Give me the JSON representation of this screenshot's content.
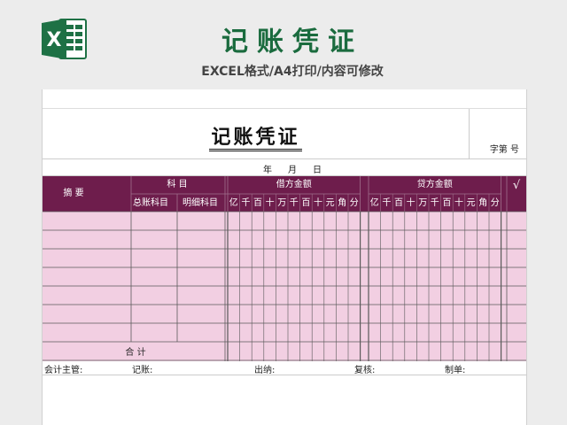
{
  "banner": {
    "title": "记账凭证",
    "subtitle": "EXCEL格式/A4打印/内容可修改"
  },
  "logo": {
    "letter": "X",
    "icon": "excel-icon",
    "color": "#1e7145"
  },
  "voucher": {
    "title": "记账凭证",
    "number_label": "字第   号",
    "date": {
      "year": "年",
      "month": "月",
      "day": "日"
    }
  },
  "table": {
    "colors": {
      "header_bg": "#6e1d4c",
      "row_bg": "#f2cfe2",
      "line": "#5a5a5a"
    },
    "headers": {
      "summary": "摘         要",
      "subject": "科         目",
      "general_subject": "总账科目",
      "detail_subject": "明细科目",
      "debit": "借方金额",
      "credit": "贷方金额",
      "check": "√"
    },
    "digits": [
      "亿",
      "千",
      "百",
      "十",
      "万",
      "千",
      "百",
      "十",
      "元",
      "角",
      "分"
    ],
    "body_rows": 7,
    "total_label": "合          计"
  },
  "footer": {
    "supervisor": "会计主管:",
    "bookkeeper": "记账:",
    "cashier": "出纳:",
    "reviewer": "复核:",
    "preparer": "制单:"
  }
}
